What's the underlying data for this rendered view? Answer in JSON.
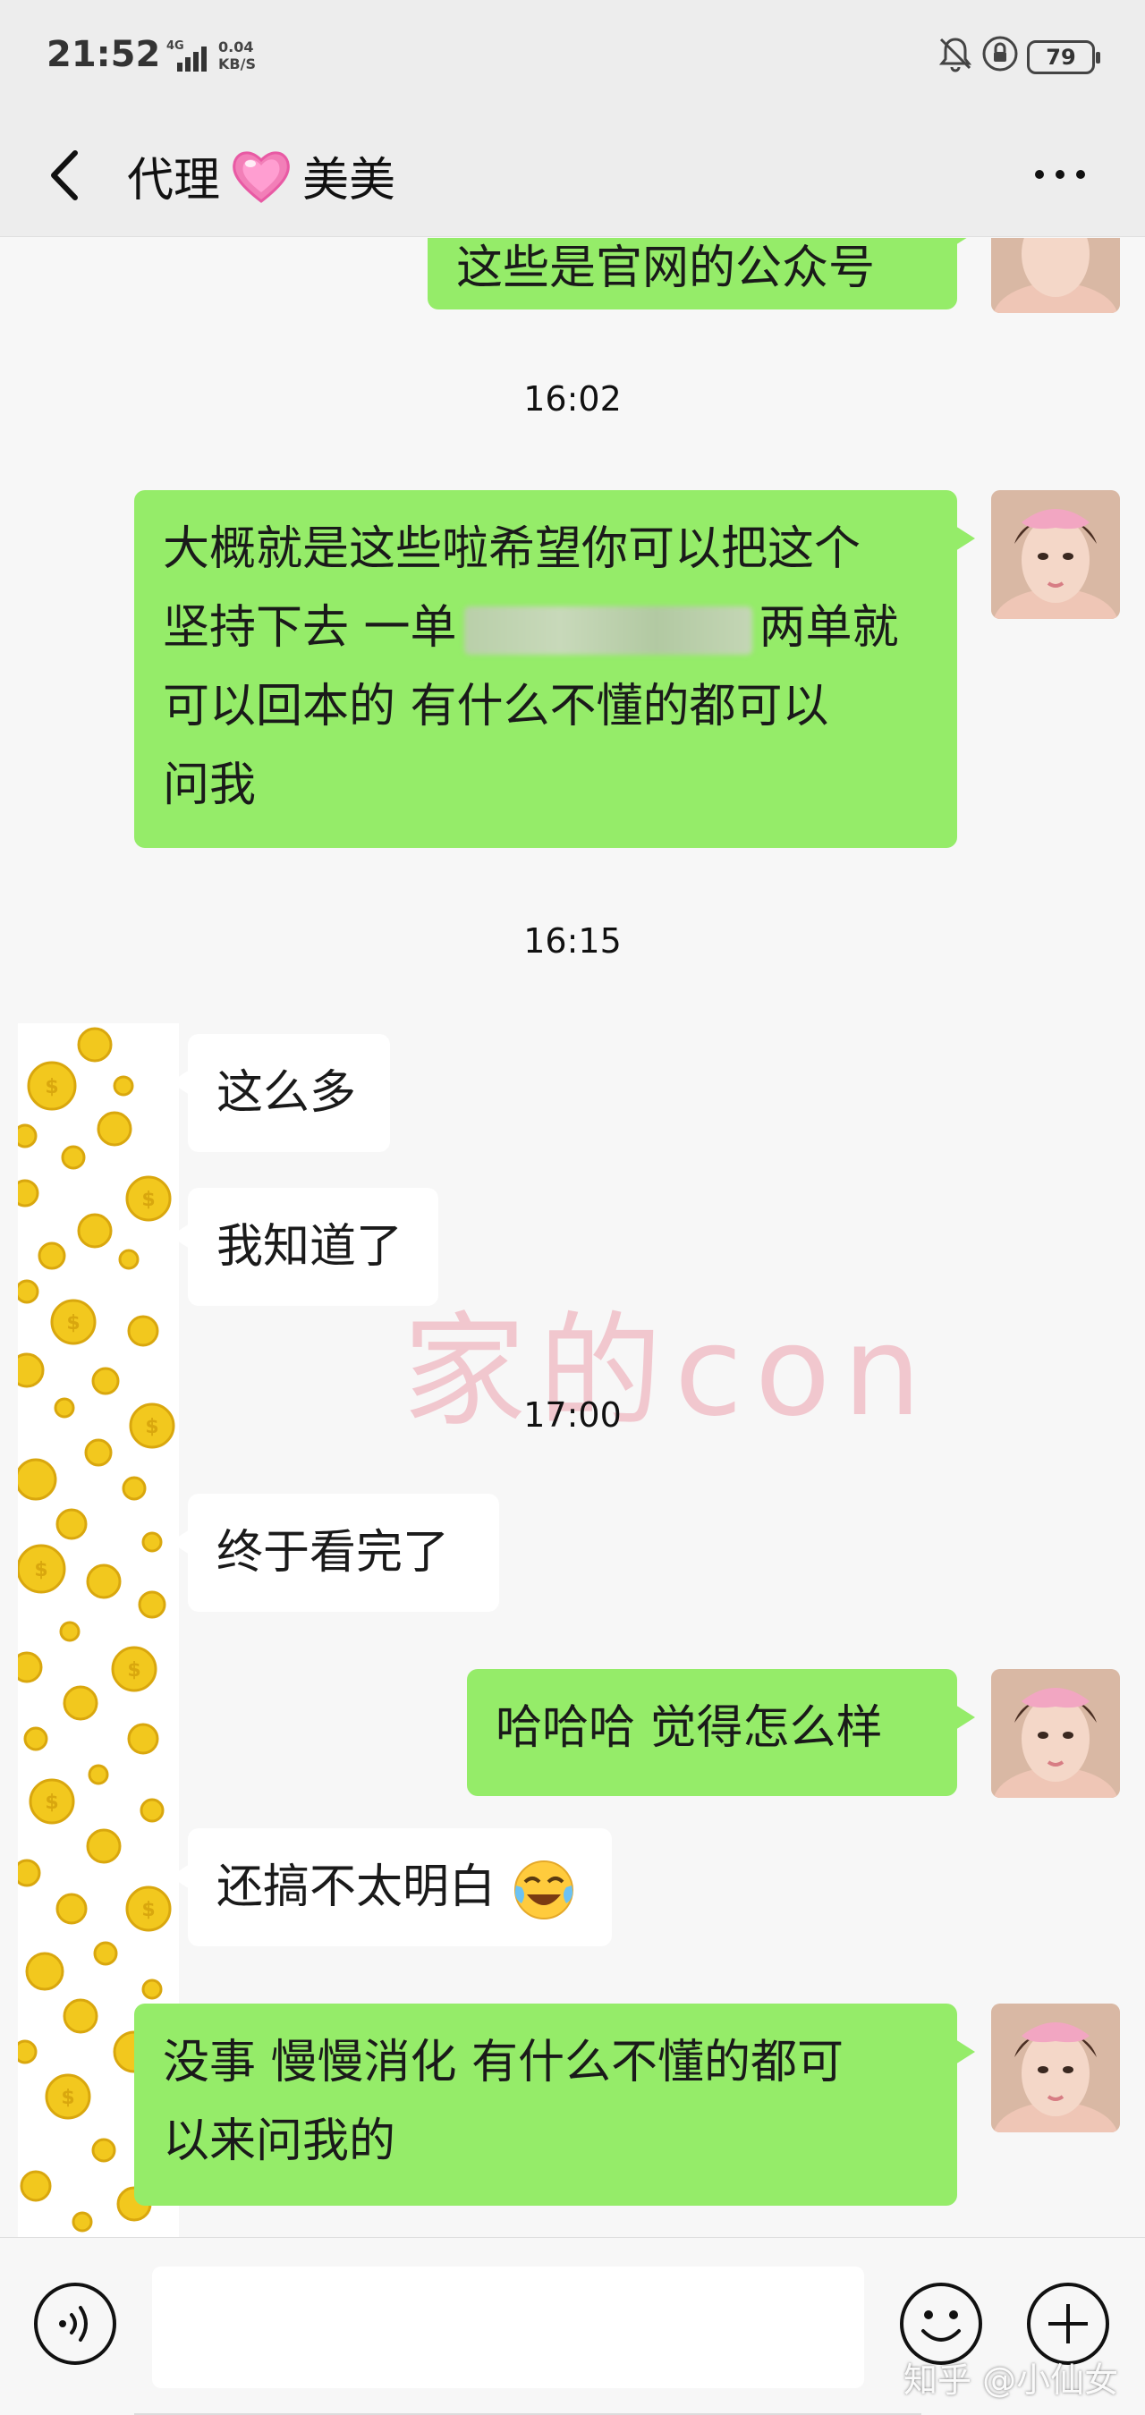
{
  "status_bar": {
    "time": "21:52",
    "network": "4G",
    "speed_value": "0.04",
    "speed_unit": "KB/S",
    "battery": "79",
    "icons": [
      "bell-off-icon",
      "lock-rotation-icon",
      "battery-icon",
      "signal-icon"
    ]
  },
  "header": {
    "name_part1": "代理",
    "heart": "heart-icon",
    "name_part2": "美美",
    "back_icon": "back-arrow-icon",
    "more_icon": "more-icon"
  },
  "messages": {
    "m0": {
      "text": "这些是官网的公众号",
      "side": "out"
    },
    "t1": "16:02",
    "m1": {
      "line1": "大概就是这些啦希望你可以把这个",
      "line2a": "坚持下去 一单",
      "line2b": "两单就",
      "line3": "可以回本的 有什么不懂的都可以",
      "line4": "问我",
      "side": "out"
    },
    "t2": "16:15",
    "m2": {
      "text": "这么多",
      "side": "in"
    },
    "m3": {
      "text": "我知道了",
      "side": "in"
    },
    "t3": "17:00",
    "m4": {
      "text": "终于看完了",
      "side": "in"
    },
    "m5": {
      "text": "哈哈哈 觉得怎么样",
      "side": "out"
    },
    "m6": {
      "text": "还搞不太明白",
      "emoji": "crying-laughing-emoji-icon",
      "side": "in"
    },
    "m7": {
      "line1": "没事 慢慢消化 有什么不懂的都可",
      "line2": "以来问我的",
      "side": "out"
    }
  },
  "watermark": "家的con",
  "input_bar": {
    "placeholder": "",
    "voice_icon": "voice-icon",
    "emoji_icon": "emoji-icon",
    "plus_icon": "plus-icon"
  },
  "source_mark": "知乎 @小仙女",
  "colors": {
    "bubble_out": "#95ec69",
    "bubble_in": "#ffffff",
    "background": "#f7f7f7",
    "header": "#ededed"
  }
}
